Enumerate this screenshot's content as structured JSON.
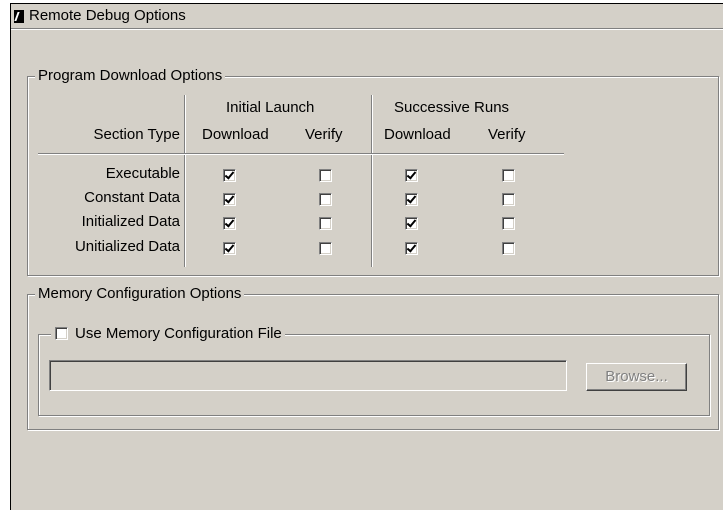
{
  "window": {
    "title": "Remote Debug Options"
  },
  "download_options": {
    "legend": "Program Download Options",
    "section_type_header": "Section Type",
    "initial_launch_header": "Initial Launch",
    "successive_runs_header": "Successive Runs",
    "download_header": "Download",
    "verify_header": "Verify",
    "rows": [
      {
        "label": "Executable",
        "initial_download": true,
        "initial_verify": false,
        "successive_download": true,
        "successive_verify": false
      },
      {
        "label": "Constant Data",
        "initial_download": true,
        "initial_verify": false,
        "successive_download": true,
        "successive_verify": false
      },
      {
        "label": "Initialized Data",
        "initial_download": true,
        "initial_verify": false,
        "successive_download": true,
        "successive_verify": false
      },
      {
        "label": "Unitialized Data",
        "initial_download": true,
        "initial_verify": false,
        "successive_download": true,
        "successive_verify": false
      }
    ]
  },
  "memory_options": {
    "legend": "Memory Configuration Options",
    "use_file_label": "Use Memory Configuration File",
    "use_file_checked": false,
    "file_path": "",
    "browse_label": "Browse..."
  }
}
